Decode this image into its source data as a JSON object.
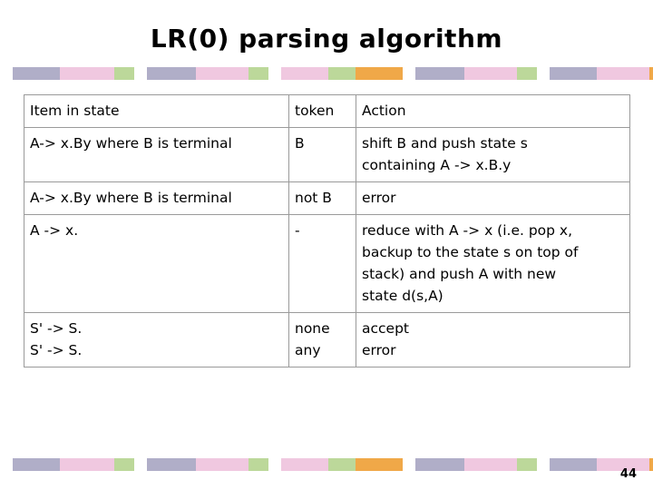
{
  "slide": {
    "title": "LR(0) parsing algorithm",
    "page_number": "44"
  },
  "decor": {
    "colors": {
      "grey": "#9a9aa8",
      "pink": "#f0c8e0",
      "green": "#bcd89a",
      "orange": "#f0a848",
      "lavender": "#b0aec8"
    },
    "top_groups": [
      [
        {
          "color": "#b0aec8",
          "width": 52
        },
        {
          "color": "#f0c8e0",
          "width": 60
        },
        {
          "color": "#bcd89a",
          "width": 22
        }
      ],
      [
        {
          "color": "#b0aec8",
          "width": 54
        },
        {
          "color": "#f0c8e0",
          "width": 58
        },
        {
          "color": "#bcd89a",
          "width": 22
        }
      ],
      [
        {
          "color": "#f0c8e0",
          "width": 52
        },
        {
          "color": "#bcd89a",
          "width": 30
        },
        {
          "color": "#f0a848",
          "width": 52
        }
      ],
      [
        {
          "color": "#b0aec8",
          "width": 54
        },
        {
          "color": "#f0c8e0",
          "width": 58
        },
        {
          "color": "#bcd89a",
          "width": 22
        }
      ],
      [
        {
          "color": "#b0aec8",
          "width": 52
        },
        {
          "color": "#f0c8e0",
          "width": 58
        },
        {
          "color": "#f0a848",
          "width": 24
        }
      ]
    ],
    "bottom_groups": [
      [
        {
          "color": "#b0aec8",
          "width": 52
        },
        {
          "color": "#f0c8e0",
          "width": 60
        },
        {
          "color": "#bcd89a",
          "width": 22
        }
      ],
      [
        {
          "color": "#b0aec8",
          "width": 54
        },
        {
          "color": "#f0c8e0",
          "width": 58
        },
        {
          "color": "#bcd89a",
          "width": 22
        }
      ],
      [
        {
          "color": "#f0c8e0",
          "width": 52
        },
        {
          "color": "#bcd89a",
          "width": 30
        },
        {
          "color": "#f0a848",
          "width": 52
        }
      ],
      [
        {
          "color": "#b0aec8",
          "width": 54
        },
        {
          "color": "#f0c8e0",
          "width": 58
        },
        {
          "color": "#bcd89a",
          "width": 22
        }
      ],
      [
        {
          "color": "#b0aec8",
          "width": 52
        },
        {
          "color": "#f0c8e0",
          "width": 58
        },
        {
          "color": "#f0a848",
          "width": 24
        }
      ]
    ]
  },
  "table": {
    "headers": {
      "item": "Item in state",
      "token": "token",
      "action": "Action"
    },
    "rows": [
      {
        "item": [
          "A-> x.By where B is terminal"
        ],
        "token": [
          "B"
        ],
        "action": [
          "shift B and push state s",
          "containing A -> x.B.y"
        ]
      },
      {
        "item": [
          "A-> x.By where B is terminal"
        ],
        "token": [
          "not B"
        ],
        "action": [
          "error"
        ]
      },
      {
        "item": [
          "A -> x."
        ],
        "token": [
          "-"
        ],
        "action": [
          "reduce with A -> x (i.e. pop x,",
          "backup to the state s on top of",
          "stack) and push A with new",
          "state d(s,A)"
        ]
      },
      {
        "item": [
          "S' -> S.",
          "S' -> S."
        ],
        "token": [
          "none",
          "any"
        ],
        "action": [
          "accept",
          "error"
        ]
      }
    ]
  }
}
